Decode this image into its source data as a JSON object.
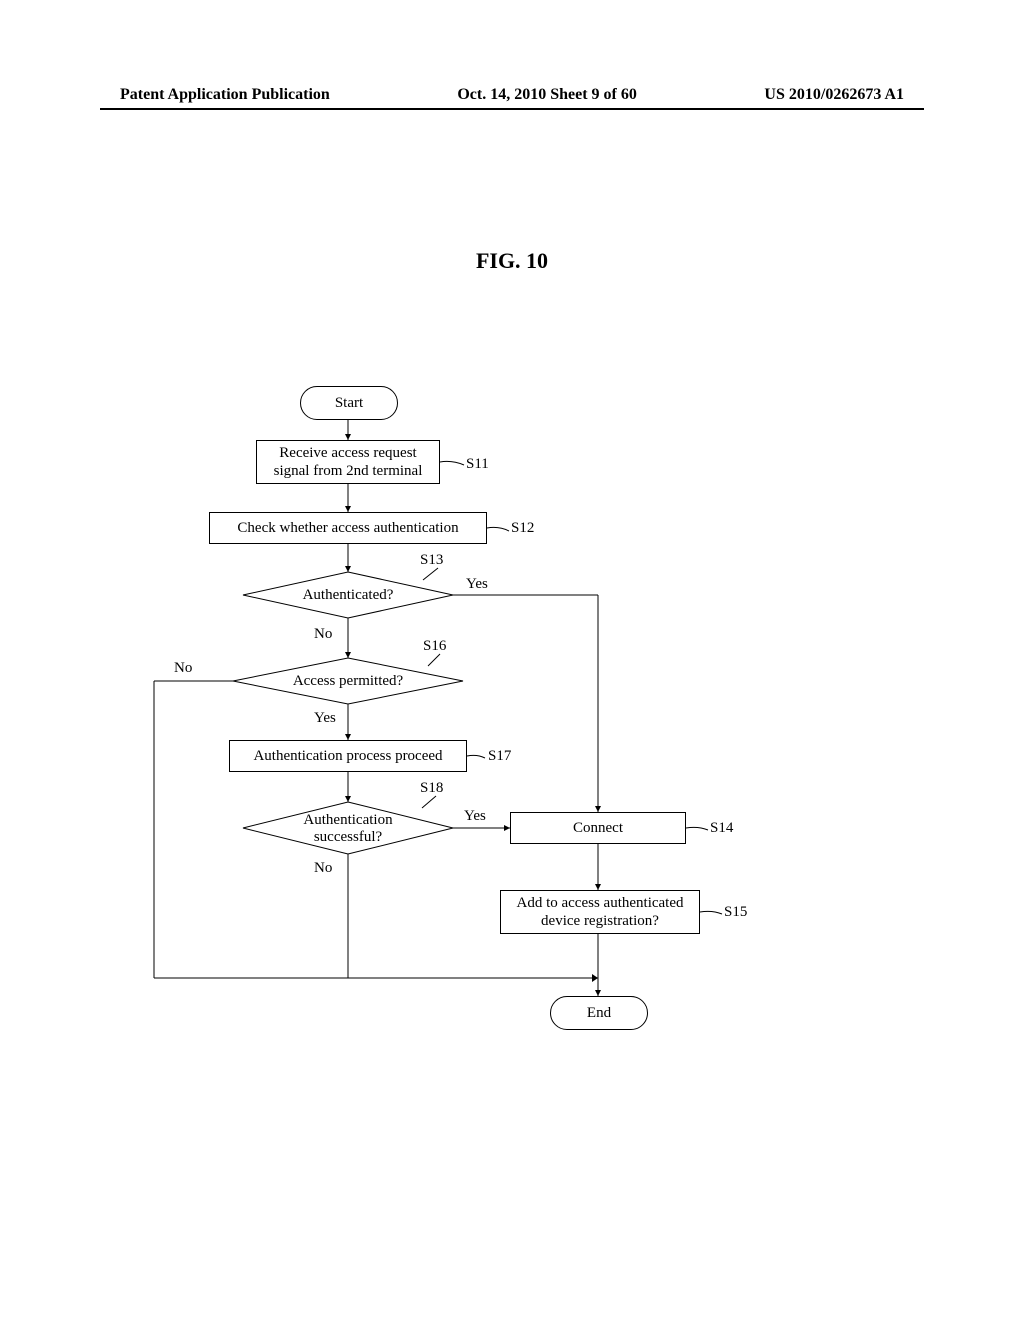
{
  "header": {
    "left": "Patent Application Publication",
    "center": "Oct. 14, 2010  Sheet 9 of 60",
    "right": "US 2010/0262673 A1"
  },
  "figure_title": "FIG. 10",
  "flow": {
    "start": "Start",
    "s11": "Receive access request\nsignal from 2nd terminal",
    "s12": "Check whether access authentication",
    "s13": "Authenticated?",
    "s16": "Access permitted?",
    "s17": "Authentication process proceed",
    "s18": "Authentication\nsuccessful?",
    "s14": "Connect",
    "s15": "Add to access authenticated\ndevice registration?",
    "end": "End",
    "labels": {
      "s11": "S11",
      "s12": "S12",
      "s13": "S13",
      "s14": "S14",
      "s15": "S15",
      "s16": "S16",
      "s17": "S17",
      "s18": "S18",
      "yes": "Yes",
      "no": "No"
    }
  }
}
